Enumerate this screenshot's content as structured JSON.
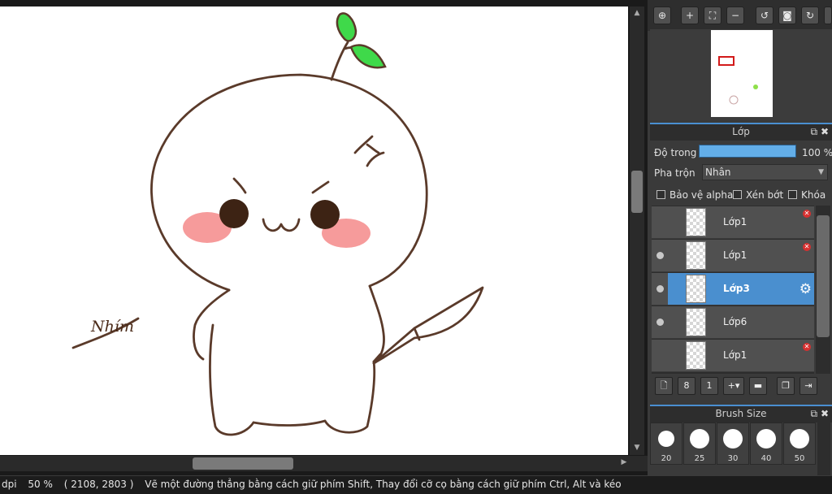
{
  "nav_toolbar": {
    "buttons": [
      "zoom-fit-icon",
      "zoom-in-icon",
      "fullscreen-icon",
      "zoom-out-icon",
      "rotate-left-icon",
      "reset-view-icon",
      "rotate-right-icon"
    ]
  },
  "layer_panel": {
    "title": "Lớp",
    "opacity_label": "Độ trong",
    "opacity_value": "100 %",
    "blend_label": "Pha trộn",
    "blend_value": "Nhân",
    "protect_alpha": "Bảo vệ alpha",
    "clipping": "Xén bớt",
    "lock": "Khóa",
    "layers": [
      {
        "name": "Lớp1",
        "visible": false,
        "selected": false,
        "deletable": true
      },
      {
        "name": "Lớp1",
        "visible": true,
        "selected": false,
        "deletable": true
      },
      {
        "name": "Lớp3",
        "visible": true,
        "selected": true,
        "deletable": false
      },
      {
        "name": "Lớp6",
        "visible": true,
        "selected": false,
        "deletable": false
      },
      {
        "name": "Lớp1",
        "visible": false,
        "selected": false,
        "deletable": true
      }
    ]
  },
  "brush_panel": {
    "title": "Brush Size",
    "sizes": [
      "20",
      "25",
      "30",
      "40",
      "50"
    ]
  },
  "canvas": {
    "signature": "Nhím"
  },
  "statusbar": {
    "dpi": "dpi",
    "zoom": "50 %",
    "coords": "( 2108, 2803 )",
    "hint": "Vẽ một đường thẳng bằng cách giữ phím Shift, Thay đổi cỡ cọ bằng cách giữ phím Ctrl, Alt và kéo"
  },
  "colors": {
    "accent": "#4a8fcf",
    "opacity_bar": "#63aee8",
    "blush": "#f48a8a",
    "leaf": "#3fd94a",
    "outline": "#5a3a2a"
  }
}
